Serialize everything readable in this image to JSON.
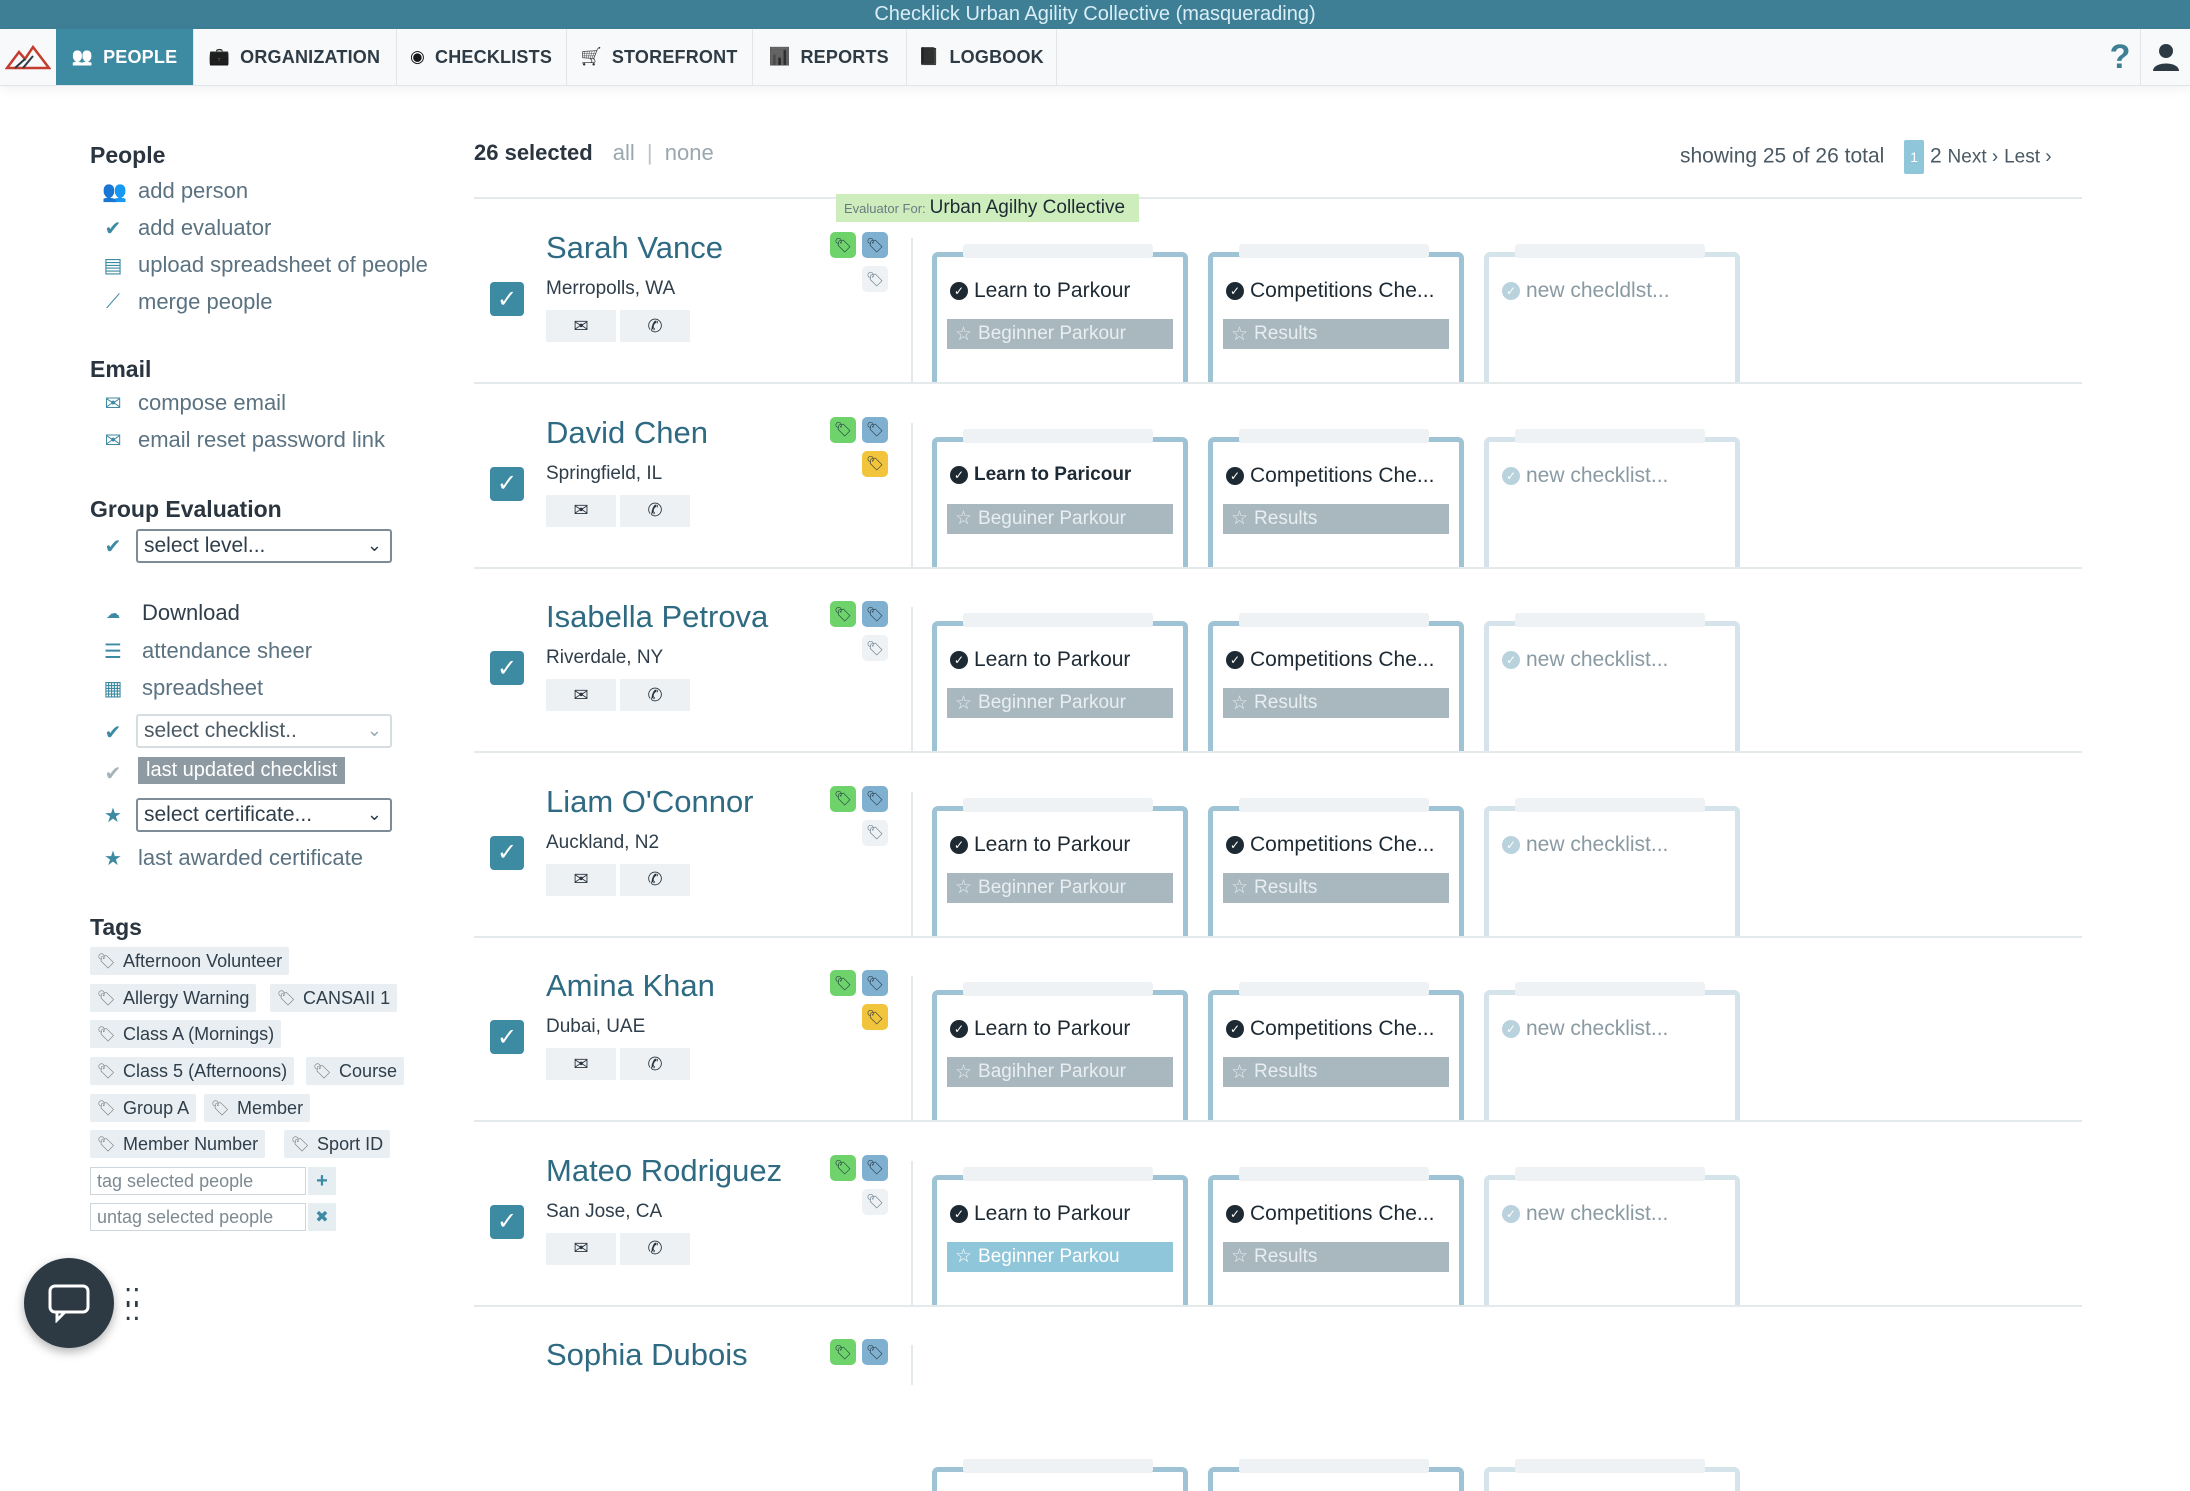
{
  "app": {
    "masquerade_banner": "Checklick Urban Agility Collective (masquerading)"
  },
  "nav": {
    "tabs": [
      {
        "label": "PEOPLE",
        "icon": "people-icon",
        "active": true
      },
      {
        "label": "ORGANIZATION",
        "icon": "briefcase-icon"
      },
      {
        "label": "CHECKLISTS",
        "icon": "globe-icon"
      },
      {
        "label": "STOREFRONT",
        "icon": "cart-icon"
      },
      {
        "label": "REPORTS",
        "icon": "bar-chart-icon"
      },
      {
        "label": "LOGBOOK",
        "icon": "book-icon"
      }
    ],
    "help": "?"
  },
  "sidebar": {
    "people_heading": "People",
    "people_links": [
      "add person",
      "add evaluator",
      "upload spreadsheet of people",
      "merge people"
    ],
    "email_heading": "Email",
    "email_links": [
      "compose email",
      "email reset password link"
    ],
    "group_eval_heading": "Group Evaluation",
    "select_level": "select level...",
    "download_label": "Download",
    "download_links": [
      "attendance sheer",
      "spreadsheet"
    ],
    "select_checklist": "select checklist..",
    "last_updated_checklist": "last updated checklist",
    "select_certificate": "select certificate...",
    "last_awarded_certificate": "last awarded certificate",
    "tags_heading": "Tags",
    "tags": [
      "Afternoon Volunteer",
      "Allergy Warning",
      "CANSAII 1",
      "Class A (Mornings)",
      "Class 5 (Afternoons)",
      "Course",
      "Group A",
      "Member",
      "Member Number",
      "Sport ID"
    ],
    "tag_placeholder": "tag selected people",
    "untag_placeholder": "untag selected people",
    "tag_add": "+",
    "untag_remove": "✖"
  },
  "selection": {
    "count_label": "26 selected",
    "all": "all",
    "sep": "|",
    "none": "none"
  },
  "pagination": {
    "showing": "showing 25 of 26 total",
    "current": "1",
    "next_page": "2",
    "next": "Next ›",
    "last": "Lest ›"
  },
  "evaluator_badge": {
    "prefix": "Evaluator For:",
    "org": "Urban Agilhy Collective"
  },
  "people": [
    {
      "name": "Sarah Vance",
      "location": "Merropolls, WA",
      "tag2_color": "w",
      "cards": [
        {
          "title": "Learn to Parkour",
          "sub": "Beginner Parkour",
          "sub_style": "grey"
        },
        {
          "title": "Competitions Che...",
          "sub": "Results"
        }
      ],
      "new_card": "new checldlst..."
    },
    {
      "name": "David Chen",
      "location": "Springfield, IL",
      "tag2_color": "y",
      "cards": [
        {
          "title": "Learn to Paricour",
          "sub": "Beguiner Parkour",
          "sub_style": "grey"
        },
        {
          "title": "Competitions Che...",
          "sub": "Results"
        }
      ],
      "new_card": "new checklist..."
    },
    {
      "name": "Isabella Petrova",
      "location": "Riverdale, NY",
      "tag2_color": "w",
      "cards": [
        {
          "title": "Learn to Parkour",
          "sub": "Beginner Parkour",
          "sub_style": "grey"
        },
        {
          "title": "Competitions Che...",
          "sub": "Results"
        }
      ],
      "new_card": "new checklist..."
    },
    {
      "name": "Liam O'Connor",
      "location": "Auckland, N2",
      "tag2_color": "w",
      "cards": [
        {
          "title": "Learn to Parkour",
          "sub": "Beginner Parkour",
          "sub_style": "grey"
        },
        {
          "title": "Competitions Che...",
          "sub": "Results"
        }
      ],
      "new_card": "new checklist..."
    },
    {
      "name": "Amina Khan",
      "location": "Dubai, UAE",
      "tag2_color": "y",
      "cards": [
        {
          "title": "Learn to Parkour",
          "sub": "Bagihher Parkour",
          "sub_style": "grey"
        },
        {
          "title": "Competitions Che...",
          "sub": "Results"
        }
      ],
      "new_card": "new checklist..."
    },
    {
      "name": "Mateo Rodriguez",
      "location": "San Jose, CA",
      "tag2_color": "w",
      "cards": [
        {
          "title": "Learn to Parkour",
          "sub": "Beginner Parkou",
          "sub_style": "blue"
        },
        {
          "title": "Competitions Che...",
          "sub": "Results"
        }
      ],
      "new_card": "new checklist..."
    },
    {
      "name": "Sophia Dubois",
      "location": "",
      "tag2_color": "",
      "cards": [],
      "new_card": ""
    }
  ],
  "colors": {
    "accent": "#3d8aa3",
    "banner": "#3f7f96",
    "name": "#2f6a83",
    "tag_green": "#6ed36a",
    "tag_blue": "#7fb0cf",
    "tag_yellow": "#f2c43b"
  }
}
